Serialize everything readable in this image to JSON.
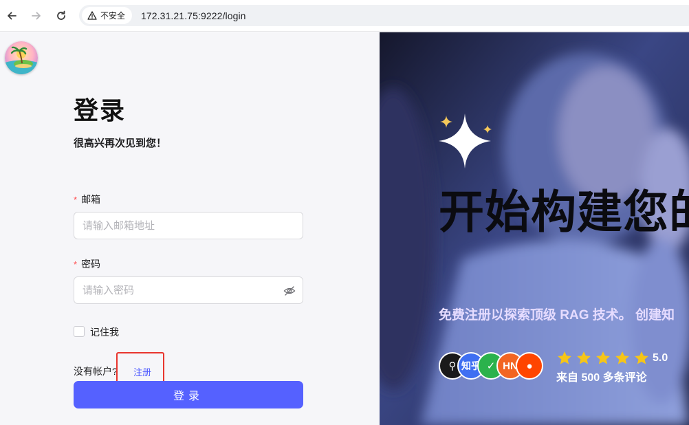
{
  "browser": {
    "security_label": "不安全",
    "url": "172.31.21.75:9222/login"
  },
  "login": {
    "title": "登录",
    "subtitle": "很高兴再次见到您！",
    "email": {
      "label": "邮箱",
      "required_mark": "*",
      "placeholder": "请输入邮箱地址"
    },
    "password": {
      "label": "密码",
      "required_mark": "*",
      "placeholder": "请输入密码"
    },
    "remember_label": "记住我",
    "no_account_text": "没有帐户?",
    "register_link": "注册",
    "submit_label": "登录"
  },
  "hero": {
    "title": "开始构建您的",
    "subtitle": "免费注册以探索顶级 RAG 技术。 创建知",
    "avatars": [
      "github",
      "zhihu",
      "wechat",
      "hacker-news",
      "reddit"
    ],
    "avatar_texts": [
      "⚲",
      "知乎",
      "✓",
      "HN",
      "●"
    ],
    "rating": 5,
    "rating_value": "5.0",
    "review_text": "来自 500 多条评论"
  },
  "colors": {
    "primary": "#5561ff",
    "link": "#4f5bff",
    "required": "#ff4d4f",
    "star": "#f5c518",
    "highlight": "#e8352e"
  }
}
